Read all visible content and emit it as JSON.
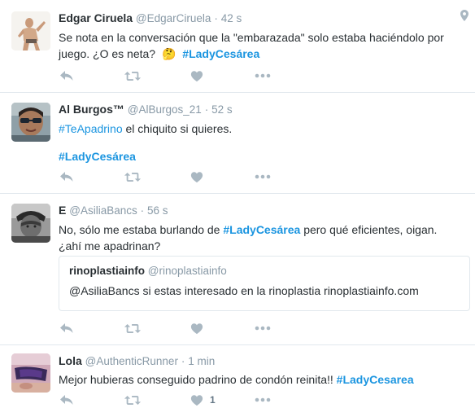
{
  "tweets": [
    {
      "fullname": "Edgar Ciruela",
      "handle": "@EdgarCiruela",
      "time": "42 s",
      "line1": "Se nota en la conversación que la \"embarazada\" solo estaba haciéndolo por",
      "line2_pre": "juego. ¿O es neta?",
      "emoji": "🤔",
      "hashtag": "#LadyCesárea"
    },
    {
      "fullname": "Al Burgos™",
      "handle": "@AlBurgos_21",
      "time": "52 s",
      "hashtag1": "#TeApadrino",
      "line1_rest": " el chiquito si quieres.",
      "hashtag2": "#LadyCesárea"
    },
    {
      "fullname": "E",
      "handle": "@AsiliaBancs",
      "time": "56 s",
      "line1_pre": "No, sólo me estaba burlando de ",
      "hashtag": "#LadyCesárea",
      "line1_post": " pero qué eficientes, oigan.",
      "line2": "¿ahí me apadrinan?",
      "quote": {
        "fullname": "rinoplastiainfo",
        "handle": "@rinoplastiainfo",
        "text": "@AsiliaBancs si estas interesado en la rinoplastia rinoplastiainfo.com"
      }
    },
    {
      "fullname": "Lola",
      "handle": "@AuthenticRunner",
      "time": "1 min",
      "line1_pre": "Mejor hubieras conseguido padrino de condón reinita!! ",
      "hashtag": "#LadyCesarea",
      "like_count": "1"
    }
  ],
  "separator": "·",
  "icons": [
    "reply-icon",
    "retweet-icon",
    "like-icon",
    "more-icon",
    "location-pin-icon"
  ],
  "colors": {
    "link": "#1b95e0",
    "muted": "#8899a6",
    "icon": "#aab8c2",
    "border": "#e1e8ed"
  }
}
